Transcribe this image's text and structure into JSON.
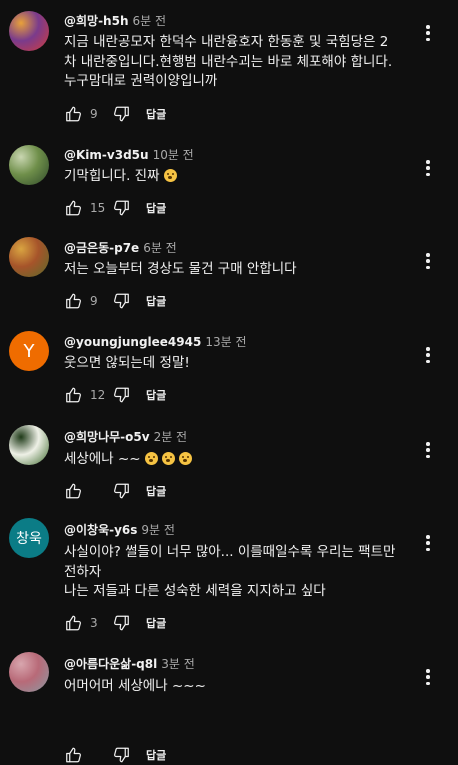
{
  "ui": {
    "reply_label": "답글"
  },
  "comments": [
    {
      "handle": "@희망-h5h",
      "time": "6분 전",
      "lines": [
        "지금 내란공모자 한덕수 내란융호자 한동훈 및 국힘당은 2",
        "차 내란중입니다.현행범 내란수괴는 바로 체포해야 합니다.",
        "누구맘대로 권력이양입니까"
      ],
      "likes": "9",
      "avatar": {
        "kind": "photo",
        "colors": [
          "#7a3b8c",
          "#d23c3c",
          "#e8a13a"
        ]
      }
    },
    {
      "handle": "@Kim-v3d5u",
      "time": "10분 전",
      "lines": [
        "기막힙니다. 진짜"
      ],
      "emoji_count": 1,
      "likes": "15",
      "avatar": {
        "kind": "photo",
        "colors": [
          "#6f8f4a",
          "#2f4a2a",
          "#c9d6b1"
        ]
      }
    },
    {
      "handle": "@금은동-p7e",
      "time": "6분 전",
      "lines": [
        "저는 오늘부터 경상도 물건 구매 안합니다"
      ],
      "likes": "9",
      "avatar": {
        "kind": "photo",
        "colors": [
          "#a6542a",
          "#5b6b2a",
          "#d9a441"
        ]
      }
    },
    {
      "handle": "@youngjunglee4945",
      "time": "13분 전",
      "lines": [
        "웃으면  않되는데 정말!"
      ],
      "likes": "12",
      "avatar": {
        "kind": "letter",
        "letter": "Y",
        "bg": "#ef6c00"
      }
    },
    {
      "handle": "@희망나무-o5v",
      "time": "2분 전",
      "lines": [
        "세상에나 ~~"
      ],
      "emoji_count": 3,
      "likes": "",
      "avatar": {
        "kind": "photo",
        "colors": [
          "#eef0e6",
          "#3f6b2f",
          "#1e3a18"
        ]
      }
    },
    {
      "handle": "@이창욱-y6s",
      "time": "9분 전",
      "lines": [
        "사실이야? 썰들이 너무 많아... 이를때일수록 우리는 팩트만",
        "전하자",
        "나는 저들과 다른 성숙한 세력을 지지하고 싶다"
      ],
      "likes": "3",
      "avatar": {
        "kind": "letter",
        "letter": "창욱",
        "bg": "#0b7c86"
      }
    },
    {
      "handle": "@아름다운삶-q8l",
      "time": "3분 전",
      "lines": [
        "어머어머 세상에나 ~~~"
      ],
      "likes": "",
      "avatar": {
        "kind": "photo",
        "colors": [
          "#b86a78",
          "#8a9aa3",
          "#d8a6ae"
        ]
      }
    }
  ]
}
